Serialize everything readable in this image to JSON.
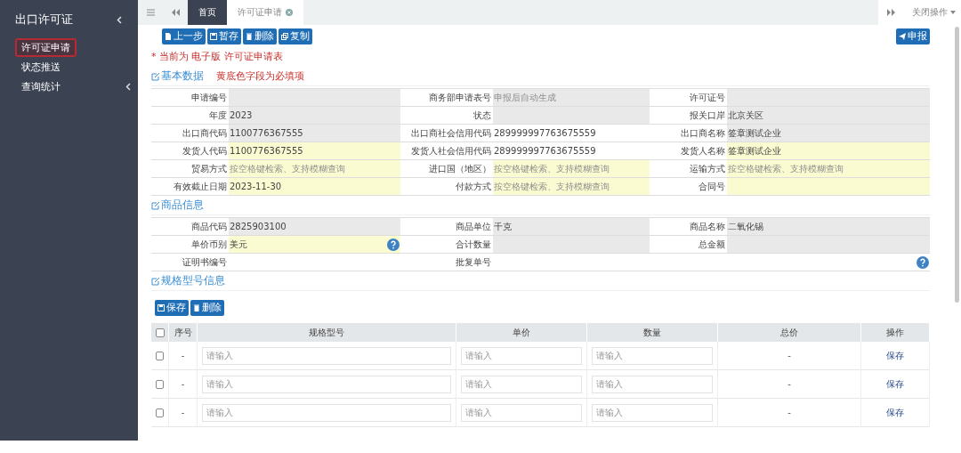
{
  "sidebar": {
    "title": "出口许可证",
    "items": [
      {
        "label": "许可证申请",
        "selected": true,
        "expandable": false
      },
      {
        "label": "状态推送",
        "selected": false,
        "expandable": false
      },
      {
        "label": "查询统计",
        "selected": false,
        "expandable": true
      }
    ]
  },
  "tabbar": {
    "tabs": [
      {
        "label": "首页",
        "selected": false,
        "closable": false
      },
      {
        "label": "许可证申请",
        "selected": true,
        "closable": true
      }
    ],
    "close_menu": "关闭操作"
  },
  "toolbar": {
    "left": [
      "上一步",
      "暂存",
      "删除",
      "复制"
    ],
    "right": "申报"
  },
  "notice": "* 当前为 电子版 许可证申请表",
  "basic": {
    "title": "基本数据",
    "note": "黄底色字段为必填项",
    "rows": [
      [
        {
          "label": "申请编号",
          "kind": "readonly"
        },
        {
          "label": "商务部申请表号",
          "kind": "readonly",
          "placeholder": "申报后自动生成"
        },
        {
          "label": "许可证号",
          "kind": "readonly"
        }
      ],
      [
        {
          "label": "年度",
          "kind": "readonly",
          "value": "2023"
        },
        {
          "label": "状态",
          "kind": "readonly"
        },
        {
          "label": "报关口岸",
          "kind": "readonly",
          "value": "北京关区"
        }
      ],
      [
        {
          "label": "出口商代码",
          "kind": "readonly",
          "value": "1100776367555"
        },
        {
          "label": "出口商社会信用代码",
          "kind": "plain",
          "value": "289999997763675559"
        },
        {
          "label": "出口商名称",
          "kind": "readonly",
          "value": "签章测试企业"
        }
      ],
      [
        {
          "label": "发货人代码",
          "kind": "required",
          "value": "1100776367555"
        },
        {
          "label": "发货人社会信用代码",
          "kind": "plain",
          "value": "289999997763675559"
        },
        {
          "label": "发货人名称",
          "kind": "required",
          "value": "签章测试企业"
        }
      ],
      [
        {
          "label": "贸易方式",
          "kind": "required",
          "placeholder": "按空格键检索、支持模糊查询"
        },
        {
          "label": "进口国（地区）",
          "kind": "required",
          "placeholder": "按空格键检索、支持模糊查询"
        },
        {
          "label": "运输方式",
          "kind": "required",
          "placeholder": "按空格键检索、支持模糊查询"
        }
      ],
      [
        {
          "label": "有效截止日期",
          "kind": "required",
          "value": "2023-11-30"
        },
        {
          "label": "付款方式",
          "kind": "required",
          "placeholder": "按空格键检索、支持模糊查询"
        },
        {
          "label": "合同号",
          "kind": "required"
        }
      ]
    ]
  },
  "goods": {
    "title": "商品信息",
    "rows": [
      [
        {
          "label": "商品代码",
          "kind": "readonly",
          "value": "2825903100"
        },
        {
          "label": "商品单位",
          "kind": "readonly",
          "value": "千克"
        },
        {
          "label": "商品名称",
          "kind": "readonly",
          "value": "二氧化锡"
        }
      ],
      [
        {
          "label": "单价币别",
          "kind": "required",
          "value": "美元",
          "help": true
        },
        {
          "label": "合计数量",
          "kind": "readonly"
        },
        {
          "label": "总金额",
          "kind": "readonly"
        }
      ],
      [
        {
          "label": "证明书编号",
          "kind": "plain"
        },
        {
          "label": "批复单号",
          "kind": "plain",
          "help": true
        }
      ]
    ]
  },
  "spec": {
    "title": "规格型号信息",
    "buttons": [
      "保存",
      "删除"
    ],
    "all_checked": false,
    "columns": [
      "序号",
      "规格型号",
      "单价",
      "数量",
      "总价",
      "操作"
    ],
    "rows": [
      {
        "checked": false,
        "seq": "-",
        "model": {
          "placeholder": "请输入"
        },
        "price": {
          "placeholder": "请输入"
        },
        "quantity": {
          "placeholder": "请输入"
        },
        "total": "-",
        "action": "保存"
      },
      {
        "checked": false,
        "seq": "-",
        "model": {
          "placeholder": "请输入"
        },
        "price": {
          "placeholder": "请输入"
        },
        "quantity": {
          "placeholder": "请输入"
        },
        "total": "-",
        "action": "保存"
      },
      {
        "checked": false,
        "seq": "-",
        "model": {
          "placeholder": "请输入"
        },
        "price": {
          "placeholder": "请输入"
        },
        "quantity": {
          "placeholder": "请输入"
        },
        "total": "-",
        "action": "保存"
      }
    ]
  }
}
